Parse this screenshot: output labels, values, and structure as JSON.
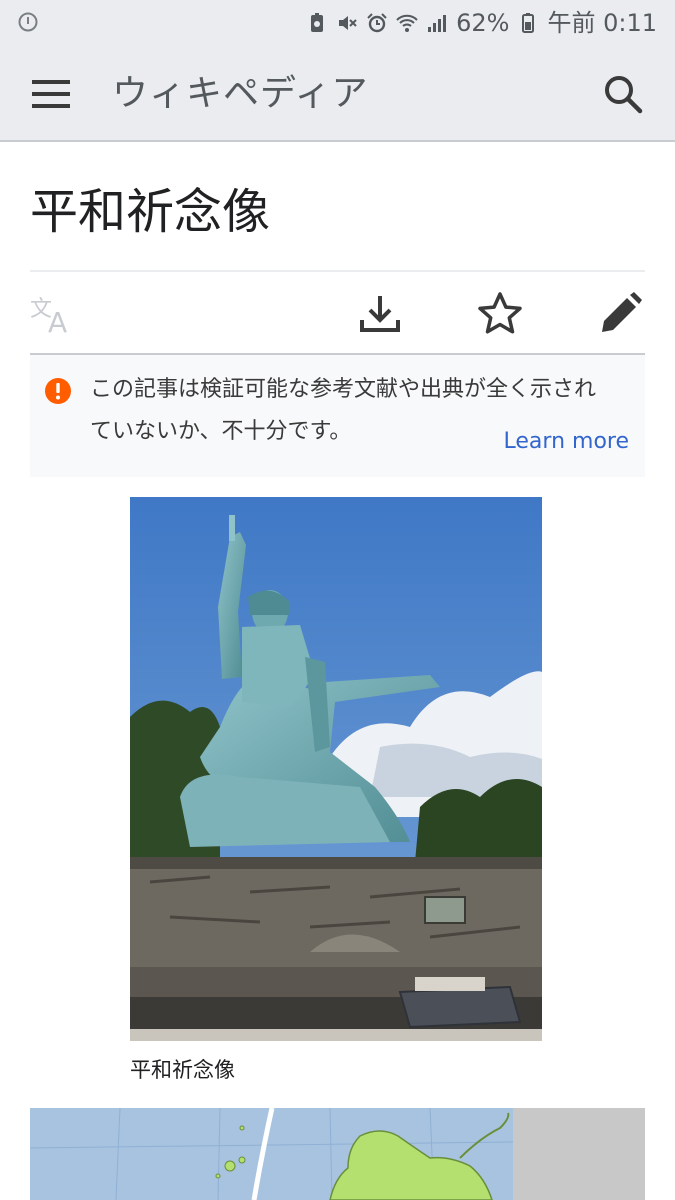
{
  "status_bar": {
    "battery": "62%",
    "time": "午前 0:11"
  },
  "header": {
    "menu_icon": "hamburger-menu-icon",
    "title": "ウィキペディア",
    "search_icon": "search-icon"
  },
  "article": {
    "title": "平和祈念像",
    "actions": [
      "language-icon",
      "download-icon",
      "star-icon",
      "edit-pencil-icon"
    ]
  },
  "notice": {
    "icon": "warning-icon",
    "line1": "この記事は検証可能な参考文献や出典が全く示され",
    "line2": "ていないか、不十分です。",
    "link": "Learn more"
  },
  "figure": {
    "caption": "平和祈念像"
  },
  "colors": {
    "chrome_bg": "#eaecf0",
    "link": "#3366cc",
    "warning": "#ff5d00"
  }
}
